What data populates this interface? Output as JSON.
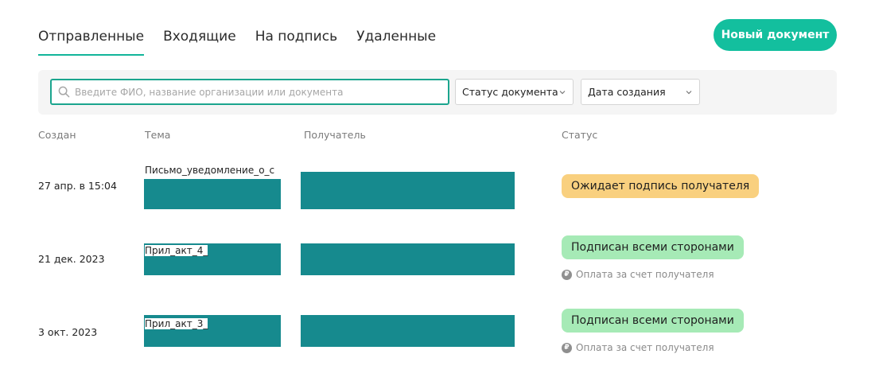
{
  "tabs": [
    {
      "label": "Отправленные",
      "active": true
    },
    {
      "label": "Входящие",
      "active": false
    },
    {
      "label": "На подпись",
      "active": false
    },
    {
      "label": "Удаленные",
      "active": false
    }
  ],
  "new_document_label": "Новый документ",
  "search": {
    "placeholder": "Введите ФИО, название организации или документа",
    "value": ""
  },
  "filters": {
    "status_label": "Статус документа",
    "date_label": "Дата создания"
  },
  "columns": {
    "created": "Создан",
    "subject": "Тема",
    "recipient": "Получатель",
    "status": "Статус"
  },
  "rows": [
    {
      "created": "27 апр. в 15:04",
      "subject": "Письмо_уведомление_о_с",
      "status": "Ожидает подпись получателя",
      "payment": ""
    },
    {
      "created": "21 дек. 2023",
      "subject": "Прил_акт_4_",
      "status": "Подписан всеми сторонами",
      "payment": "Оплата за счет получателя"
    },
    {
      "created": "3 окт. 2023",
      "subject": "Прил_акт_3_",
      "status": "Подписан всеми сторонами",
      "payment": "Оплата за счет получателя"
    }
  ],
  "colors": {
    "accent": "#13bf9e",
    "redaction": "#168a8e",
    "status_waiting": "#f9d07f",
    "status_signed": "#a6eab6"
  },
  "icons": {
    "search": "search-icon",
    "dropdown": "chevron-down-icon",
    "currency": "ruble-icon"
  }
}
